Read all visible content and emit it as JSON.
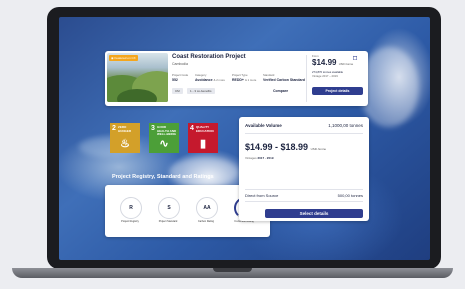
{
  "project": {
    "badge": "Featured on CX",
    "title": "Coast Restoration Project",
    "country": "Cambodia",
    "fields": [
      {
        "label": "Project Code",
        "value": "552"
      },
      {
        "label": "Category",
        "value": "Avoidance",
        "extra": "& 2 more"
      },
      {
        "label": "Project Type",
        "value": "REDD+",
        "extra": "& 1 more"
      },
      {
        "label": "Standard",
        "value": "Verified Carbon Standard"
      }
    ],
    "tags": [
      "CM",
      "1 - 3 co-benefits"
    ],
    "compare_label": "Compare",
    "price_label": "From",
    "price": "$14.99",
    "price_unit": "USD /tonne",
    "available": "274,870 tonnes available",
    "vintage": "Vintage 2017 – 2019",
    "details_label": "Project details"
  },
  "sdgs": [
    {
      "num": "2",
      "label": "ZERO HUNGER",
      "color": "#d3a029",
      "icon": "bowl-icon",
      "glyph": "♨"
    },
    {
      "num": "3",
      "label": "GOOD HEALTH AND WELL-BEING",
      "color": "#4c9f38",
      "icon": "heartbeat-icon",
      "glyph": "∿"
    },
    {
      "num": "4",
      "label": "QUALITY EDUCATION",
      "color": "#c5192d",
      "icon": "book-icon",
      "glyph": "▮"
    }
  ],
  "ratings_panel": {
    "title": "Project Registry, Standard and Ratings",
    "items": [
      {
        "badge": "R",
        "label": "Project Registry"
      },
      {
        "badge": "S",
        "label": "Project Standard"
      },
      {
        "badge": "AA",
        "label": "Carbon Rating"
      },
      {
        "badge": "4/5",
        "label": "Co-benefit Rating"
      }
    ]
  },
  "volume": {
    "label": "Available Volume",
    "amount": "1,1000,00 tonnes",
    "price_range": "$14.99 - $18.99",
    "price_unit": "USD /tonne",
    "vintages_label": "Vintages",
    "vintages_value": "2017 - 2019",
    "source_label": "Direct from Source",
    "source_amount": "500,00 tonnes",
    "select_label": "Select details"
  },
  "colors": {
    "accent": "#2f3d8f",
    "badge": "#f4a61d"
  }
}
